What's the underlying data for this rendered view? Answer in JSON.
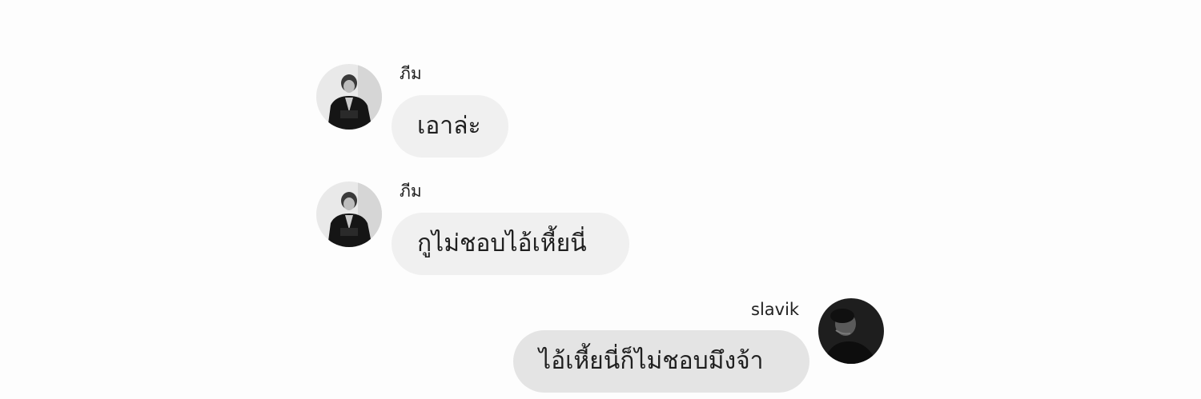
{
  "messages": [
    {
      "sender": "ภีม",
      "text": "เอาล่ะ",
      "direction": "incoming",
      "avatar": "user-avatar-bhim"
    },
    {
      "sender": "ภีม",
      "text": "กูไม่ชอบไอ้เหี้ยนี่",
      "direction": "incoming",
      "avatar": "user-avatar-bhim"
    },
    {
      "sender": "slavik",
      "text": "ไอ้เหี้ยนี่ก็ไม่ชอบมึงจ้า",
      "direction": "outgoing",
      "avatar": "user-avatar-slavik"
    }
  ],
  "colors": {
    "background": "#fdfdfd",
    "incoming_bubble": "#f0f0f0",
    "outgoing_bubble": "#e4e4e4",
    "text": "#1f1f1f"
  }
}
